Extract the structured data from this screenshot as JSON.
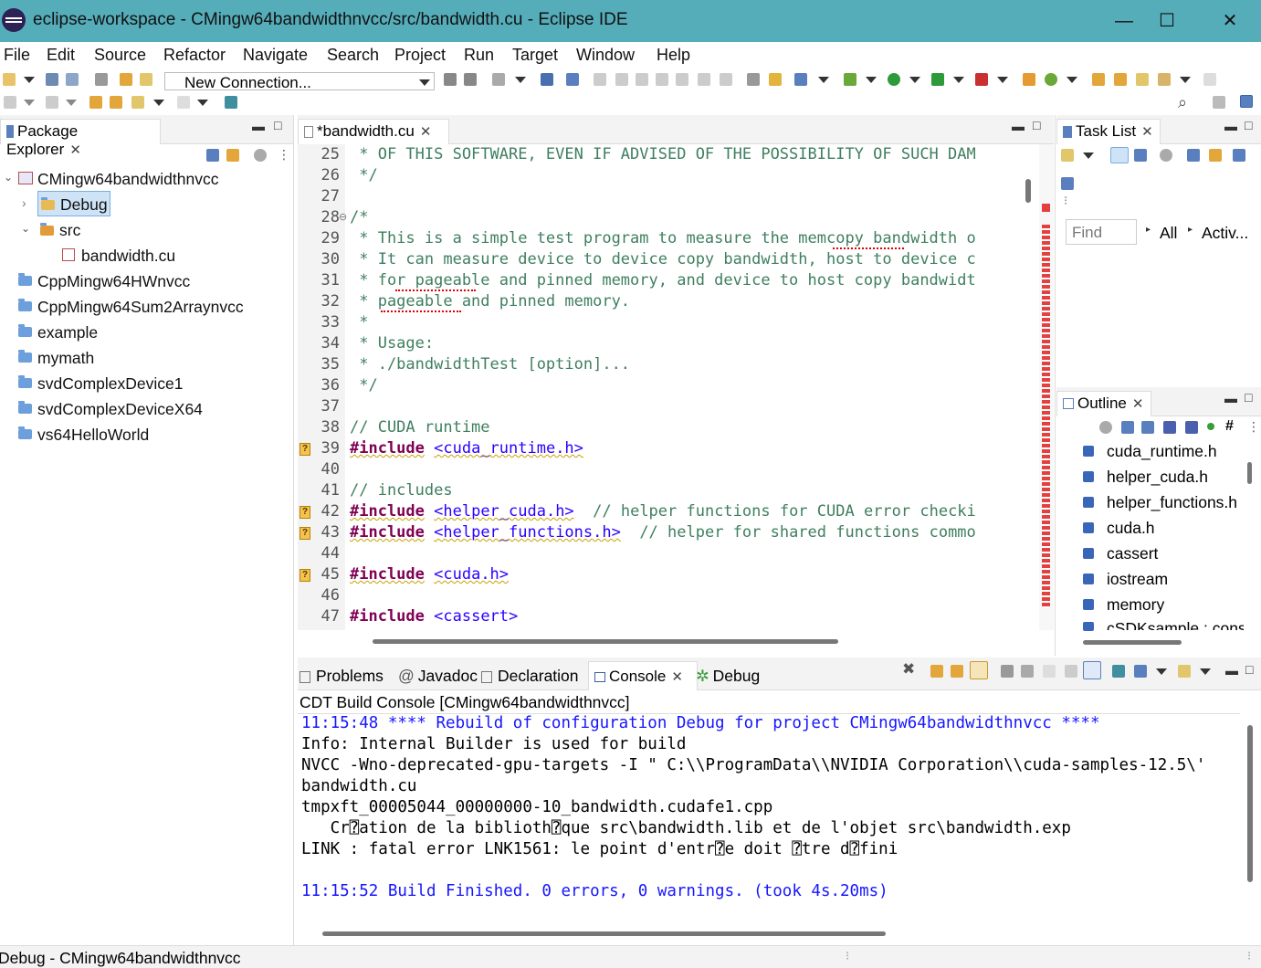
{
  "window": {
    "title": "eclipse-workspace - CMingw64bandwidthnvcc/src/bandwidth.cu - Eclipse IDE",
    "minimize": "—",
    "maximize": "☐",
    "close": "✕"
  },
  "menu": [
    "File",
    "Edit",
    "Source",
    "Refactor",
    "Navigate",
    "Search",
    "Project",
    "Run",
    "Target",
    "Window",
    "Help"
  ],
  "toolbar": {
    "connection": "New Connection..."
  },
  "package_explorer": {
    "tab": "Package Explorer",
    "items": [
      {
        "label": "CMingw64bandwidthnvcc"
      },
      {
        "label": "Debug"
      },
      {
        "label": "src"
      },
      {
        "label": "bandwidth.cu"
      },
      {
        "label": "CppMingw64HWnvcc"
      },
      {
        "label": "CppMingw64Sum2Arraynvcc"
      },
      {
        "label": "example"
      },
      {
        "label": "mymath"
      },
      {
        "label": "svdComplexDevice1"
      },
      {
        "label": "svdComplexDeviceX64"
      },
      {
        "label": "vs64HelloWorld"
      }
    ]
  },
  "editor": {
    "tab": "*bandwidth.cu",
    "lines": [
      {
        "n": "25",
        "text": " * OF THIS SOFTWARE, EVEN IF ADVISED OF THE POSSIBILITY OF SUCH DAM"
      },
      {
        "n": "26",
        "text": " */"
      },
      {
        "n": "27",
        "text": ""
      },
      {
        "n": "28",
        "text": "/*"
      },
      {
        "n": "29",
        "text": " * This is a simple test program to measure the memcopy bandwidth o"
      },
      {
        "n": "30",
        "text": " * It can measure device to device copy bandwidth, host to device c"
      },
      {
        "n": "31",
        "text": " * for pageable and pinned memory, and device to host copy bandwidt"
      },
      {
        "n": "32",
        "text": " * pageable and pinned memory."
      },
      {
        "n": "33",
        "text": " *"
      },
      {
        "n": "34",
        "text": " * Usage:"
      },
      {
        "n": "35",
        "text": " * ./bandwidthTest [option]..."
      },
      {
        "n": "36",
        "text": " */"
      },
      {
        "n": "37",
        "text": ""
      },
      {
        "n": "38",
        "text": "// CUDA runtime"
      },
      {
        "n": "39",
        "kw": "#include",
        "inc": "<cuda_runtime.h>"
      },
      {
        "n": "40",
        "text": ""
      },
      {
        "n": "41",
        "text": "// includes"
      },
      {
        "n": "42",
        "kw": "#include",
        "inc": "<helper_cuda.h>",
        "cm": "  // helper functions for CUDA error checki"
      },
      {
        "n": "43",
        "kw": "#include",
        "inc": "<helper_functions.h>",
        "cm": "  // helper for shared functions commo"
      },
      {
        "n": "44",
        "text": ""
      },
      {
        "n": "45",
        "kw": "#include",
        "inc": "<cuda.h>"
      },
      {
        "n": "46",
        "text": ""
      },
      {
        "n": "47",
        "kw": "#include",
        "inc": "<cassert>"
      }
    ]
  },
  "task_list": {
    "tab": "Task List",
    "find_placeholder": "Find",
    "all": "All",
    "activate": "Activ..."
  },
  "outline": {
    "tab": "Outline",
    "items": [
      "cuda_runtime.h",
      "helper_cuda.h",
      "helper_functions.h",
      "cuda.h",
      "cassert",
      "iostream",
      "memory",
      "cSDKsample : cons"
    ]
  },
  "bottom_tabs": [
    "Problems",
    "Javadoc",
    "Declaration",
    "Console",
    "Debug"
  ],
  "console": {
    "header": "CDT Build Console [CMingw64bandwidthnvcc]",
    "lines": [
      {
        "text": "11:15:48 **** Rebuild of configuration Debug for project CMingw64bandwidthnvcc ****",
        "color": "blue"
      },
      {
        "text": "Info: Internal Builder is used for build",
        "color": "black"
      },
      {
        "text": "NVCC -Wno-deprecated-gpu-targets -I \" C:\\\\ProgramData\\\\NVIDIA Corporation\\\\cuda-samples-12.5\\'",
        "color": "black"
      },
      {
        "text": "bandwidth.cu",
        "color": "black"
      },
      {
        "text": "tmpxft_00005044_00000000-10_bandwidth.cudafe1.cpp",
        "color": "black"
      },
      {
        "text": "   Cr⍰ation de la biblioth⍰que src\\bandwidth.lib et de l'objet src\\bandwidth.exp",
        "color": "black"
      },
      {
        "text": "LINK : fatal error LNK1561: le point d'entr⍰e doit ⍰tre d⍰fini",
        "color": "black"
      },
      {
        "text": "",
        "color": "black"
      },
      {
        "text": "11:15:52 Build Finished. 0 errors, 0 warnings. (took 4s.20ms)",
        "color": "blue"
      }
    ]
  },
  "status_bar": {
    "text": "Debug - CMingw64bandwidthnvcc"
  },
  "colors": {
    "titlebar": "#55adba",
    "keyword": "#7f0055",
    "include": "#2a00ff",
    "comment": "#3f7f5f",
    "console_blue": "#1616ff"
  }
}
